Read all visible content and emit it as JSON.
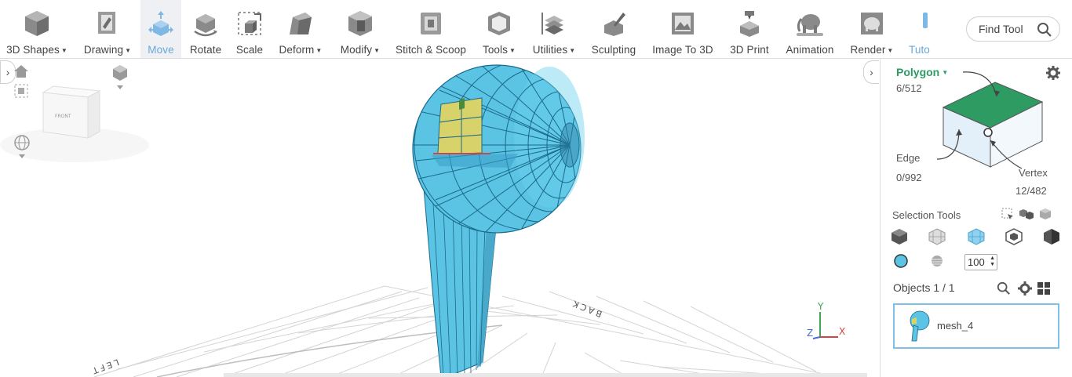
{
  "toolbar": {
    "items": [
      {
        "label": "3D Shapes",
        "dropdown": true
      },
      {
        "label": "Drawing",
        "dropdown": true
      },
      {
        "label": "Move",
        "dropdown": false,
        "active": true
      },
      {
        "label": "Rotate",
        "dropdown": false
      },
      {
        "label": "Scale",
        "dropdown": false
      },
      {
        "label": "Deform",
        "dropdown": true
      },
      {
        "label": "Modify",
        "dropdown": true
      },
      {
        "label": "Stitch & Scoop",
        "dropdown": false
      },
      {
        "label": "Tools",
        "dropdown": true
      },
      {
        "label": "Utilities",
        "dropdown": true
      },
      {
        "label": "Sculpting",
        "dropdown": false
      },
      {
        "label": "Image To 3D",
        "dropdown": false
      },
      {
        "label": "3D Print",
        "dropdown": false
      },
      {
        "label": "Animation",
        "dropdown": false
      },
      {
        "label": "Render",
        "dropdown": true
      },
      {
        "label": "Tuto",
        "dropdown": false
      }
    ],
    "find_tool": "Find Tool"
  },
  "viewport": {
    "view_cube_face": "FRONT",
    "floor_label_back": "BACK",
    "floor_label_left": "LEFT",
    "axis_x": "X",
    "axis_y": "Y",
    "axis_z": "Z"
  },
  "panel": {
    "mode_label": "Polygon",
    "polygon_count": "6/512",
    "edge_label": "Edge",
    "edge_count": "0/992",
    "vertex_label": "Vertex",
    "vertex_count": "12/482",
    "selection_tools_label": "Selection Tools",
    "brush_size": "100",
    "objects_label": "Objects 1 / 1",
    "object_name": "mesh_4"
  },
  "colors": {
    "accent": "#6aa7d8",
    "mesh": "#5bc3e4",
    "selection": "#d8d26a",
    "mode_green": "#2e9b63"
  }
}
